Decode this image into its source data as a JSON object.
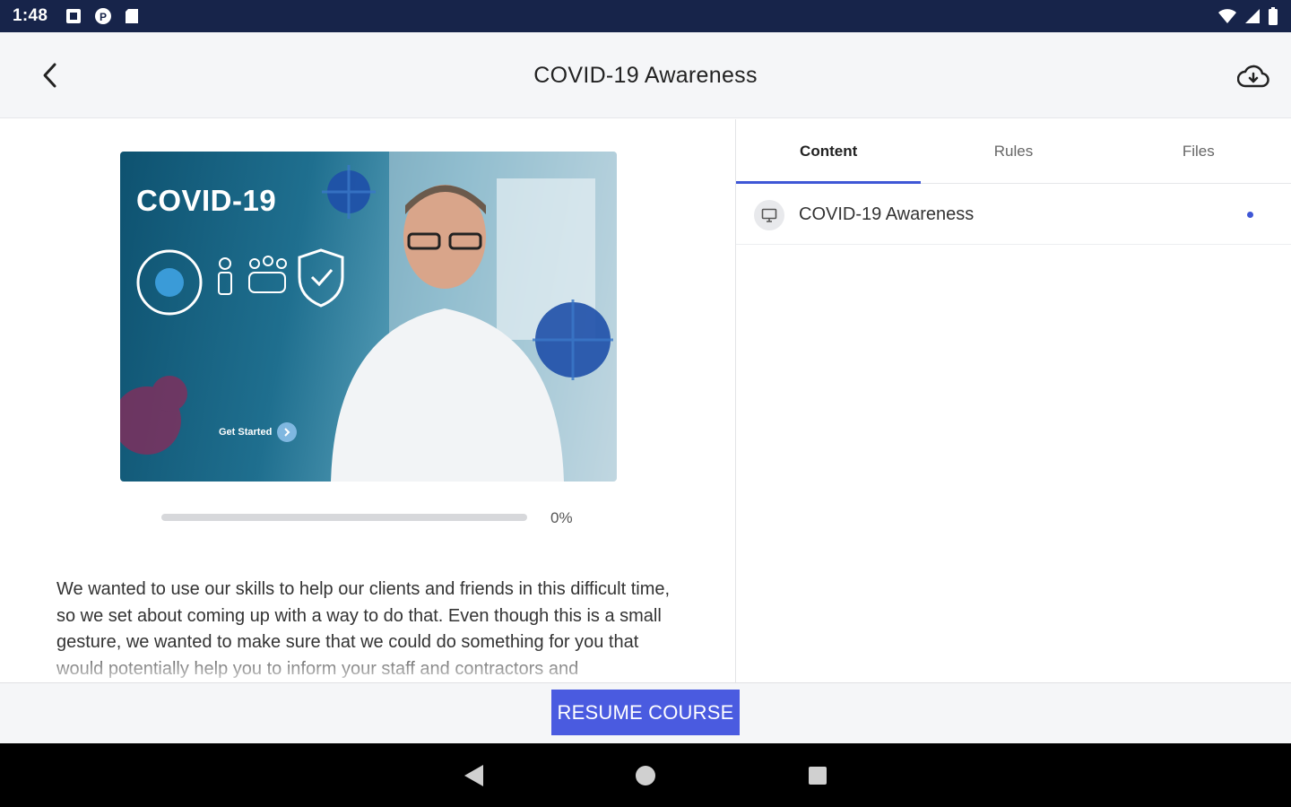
{
  "status_bar": {
    "time": "1:48",
    "left_icons": [
      "notification-square-icon",
      "media-p-icon",
      "sd-card-icon"
    ],
    "right_icons": [
      "wifi-icon",
      "cell-signal-icon",
      "battery-icon"
    ]
  },
  "app_bar": {
    "title": "COVID-19 Awareness",
    "back_icon": "chevron-left-icon",
    "download_icon": "cloud-download-icon"
  },
  "course": {
    "hero": {
      "title": "COVID-19",
      "cta": "Get Started"
    },
    "progress_fraction": 0,
    "progress_text": "0%",
    "description": "We wanted to use our skills to help our clients and friends in this difficult time, so we set about coming up with a way to do that. Even though this is a small gesture, we wanted to make sure that we could do something for you that would potentially help you to inform your staff and contractors and"
  },
  "tabs": [
    {
      "label": "Content",
      "active": true
    },
    {
      "label": "Rules",
      "active": false
    },
    {
      "label": "Files",
      "active": false
    }
  ],
  "content_items": [
    {
      "label": "COVID-19 Awareness",
      "icon": "monitor-icon",
      "unread": true
    }
  ],
  "action": {
    "resume_label": "RESUME COURSE"
  },
  "colors": {
    "status_bar": "#17244a",
    "accent": "#3f57d6",
    "button": "#4a5be0"
  }
}
